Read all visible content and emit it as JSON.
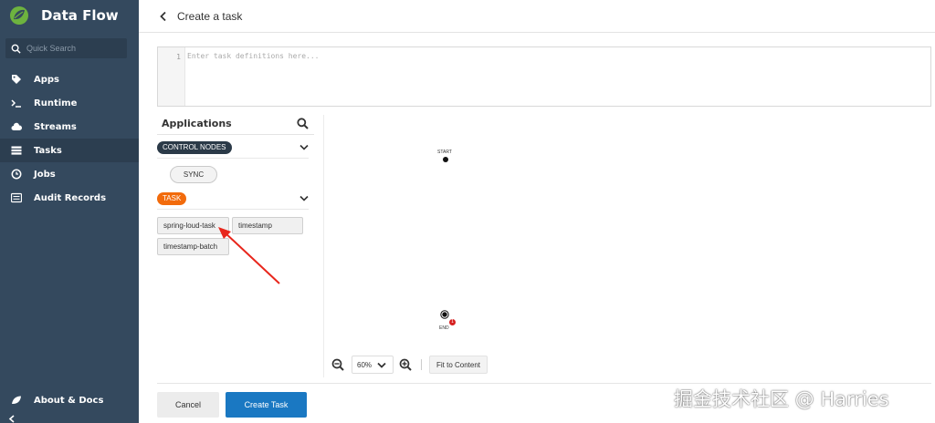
{
  "sidebar": {
    "brand": "Data Flow",
    "search_placeholder": "Quick Search",
    "items": [
      {
        "label": "Apps",
        "icon": "tag-icon"
      },
      {
        "label": "Runtime",
        "icon": "terminal-icon"
      },
      {
        "label": "Streams",
        "icon": "cloud-icon"
      },
      {
        "label": "Tasks",
        "icon": "tasks-icon",
        "active": true
      },
      {
        "label": "Jobs",
        "icon": "clock-icon"
      },
      {
        "label": "Audit Records",
        "icon": "list-icon"
      }
    ],
    "about": "About & Docs",
    "colors": {
      "background": "#34495e",
      "active": "#2c3e50"
    }
  },
  "header": {
    "title": "Create a task"
  },
  "editor": {
    "line_number": "1",
    "placeholder": "Enter task definitions here..."
  },
  "palette": {
    "title": "Applications",
    "groups": [
      {
        "badge": "CONTROL NODES",
        "color": "#2b3a48",
        "apps": [
          "SYNC"
        ]
      },
      {
        "badge": "TASK",
        "color": "#f26b0c",
        "apps": [
          "spring-loud-task",
          "timestamp",
          "timestamp-batch"
        ]
      }
    ]
  },
  "canvas": {
    "start_label": "START",
    "end_label": "END",
    "error_count": "1",
    "zoom_level": "60%",
    "fit_label": "Fit to Content"
  },
  "footer": {
    "cancel_label": "Cancel",
    "create_label": "Create Task",
    "accent": "#1a78c2"
  },
  "watermark": "掘金技术社区 @ Harries"
}
